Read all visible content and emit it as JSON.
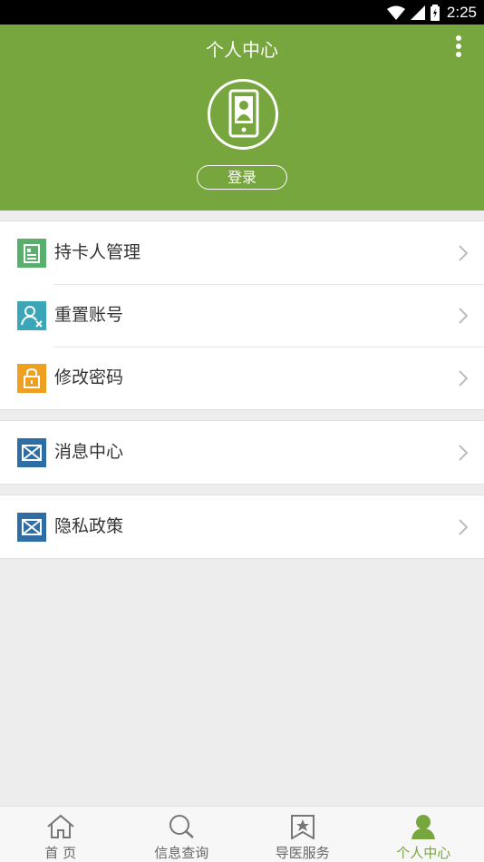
{
  "status_bar": {
    "time": "2:25"
  },
  "header": {
    "title": "个人中心",
    "login_label": "登录"
  },
  "menu": {
    "group1": [
      {
        "label": "持卡人管理",
        "icon": "card-holder-icon",
        "color": "#5aae6e"
      },
      {
        "label": "重置账号",
        "icon": "reset-account-icon",
        "color": "#3aa6b8"
      },
      {
        "label": "修改密码",
        "icon": "lock-icon",
        "color": "#f0a020"
      }
    ],
    "group2": [
      {
        "label": "消息中心",
        "icon": "mail-icon",
        "color": "#2f6ea5"
      }
    ],
    "group3": [
      {
        "label": "隐私政策",
        "icon": "mail-icon",
        "color": "#2f6ea5"
      }
    ]
  },
  "bottom_nav": {
    "tabs": [
      {
        "label": "首 页",
        "icon": "home-icon"
      },
      {
        "label": "信息查询",
        "icon": "search-icon"
      },
      {
        "label": "导医服务",
        "icon": "bookmark-star-icon"
      },
      {
        "label": "个人中心",
        "icon": "person-icon",
        "active": true
      }
    ]
  },
  "colors": {
    "brand_green": "#78a63e",
    "background": "#ededed"
  }
}
